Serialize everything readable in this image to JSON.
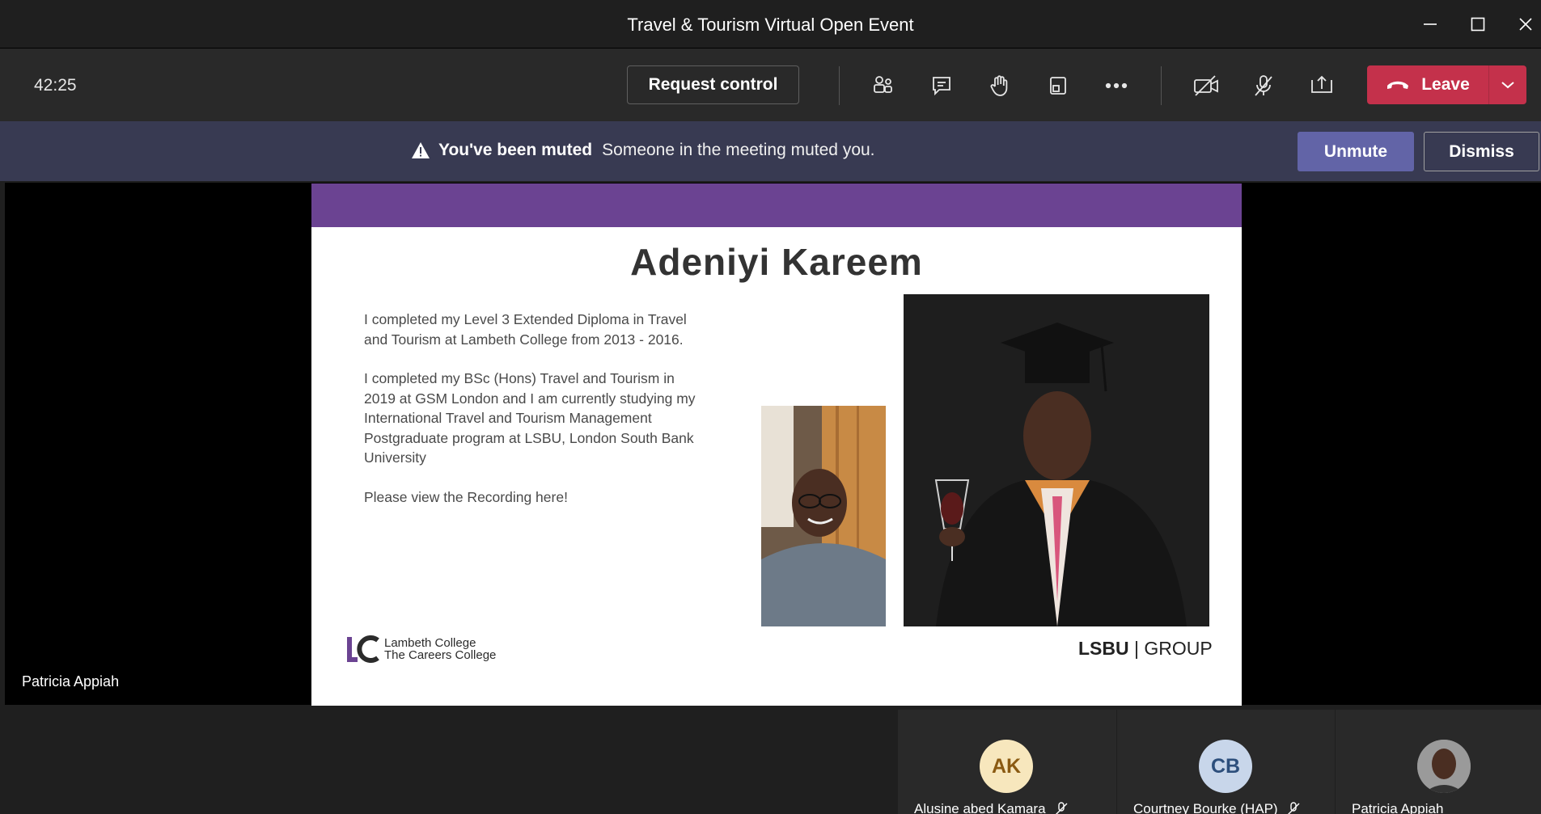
{
  "window": {
    "title": "Travel & Tourism Virtual Open Event"
  },
  "toolbar": {
    "timer": "42:25",
    "request_control_label": "Request control",
    "icons": [
      "people-icon",
      "chat-icon",
      "raise-hand-icon",
      "rooms-icon",
      "more-icon",
      "camera-off-icon",
      "mic-off-icon",
      "share-icon"
    ],
    "leave_label": "Leave"
  },
  "banner": {
    "title": "You've been muted",
    "message": "Someone in the meeting muted you.",
    "unmute_label": "Unmute",
    "dismiss_label": "Dismiss"
  },
  "stage": {
    "presenter_name": "Patricia Appiah"
  },
  "slide": {
    "title": "Adeniyi Kareem",
    "paragraphs": [
      "I completed my Level 3 Extended Diploma in Travel and Tourism at Lambeth College from 2013 - 2016.",
      "I completed my BSc (Hons) Travel and Tourism in 2019 at GSM London and I am currently studying my International Travel and Tourism Management Postgraduate program at LSBU, London South Bank University",
      "Please view the Recording here!"
    ],
    "lc_logo": {
      "mark": "LC",
      "line1": "Lambeth College",
      "line2": "The Careers College"
    },
    "lsbu_logo": {
      "bold": "LSBU",
      "sep": "|",
      "rest": "GROUP"
    },
    "accent_color": "#6b4392"
  },
  "participants": [
    {
      "initials": "AK",
      "name": "Alusine abed Kamara",
      "avatar_bg": "#f7e7bd",
      "avatar_fg": "#8a5a12"
    },
    {
      "initials": "CB",
      "name": "Courtney Bourke (HAP)",
      "avatar_bg": "#c8d6ea",
      "avatar_fg": "#2d4f7c"
    },
    {
      "initials": "",
      "name": "Patricia Appiah",
      "avatar_bg": "#6d6d6d",
      "avatar_fg": "#ffffff"
    }
  ]
}
